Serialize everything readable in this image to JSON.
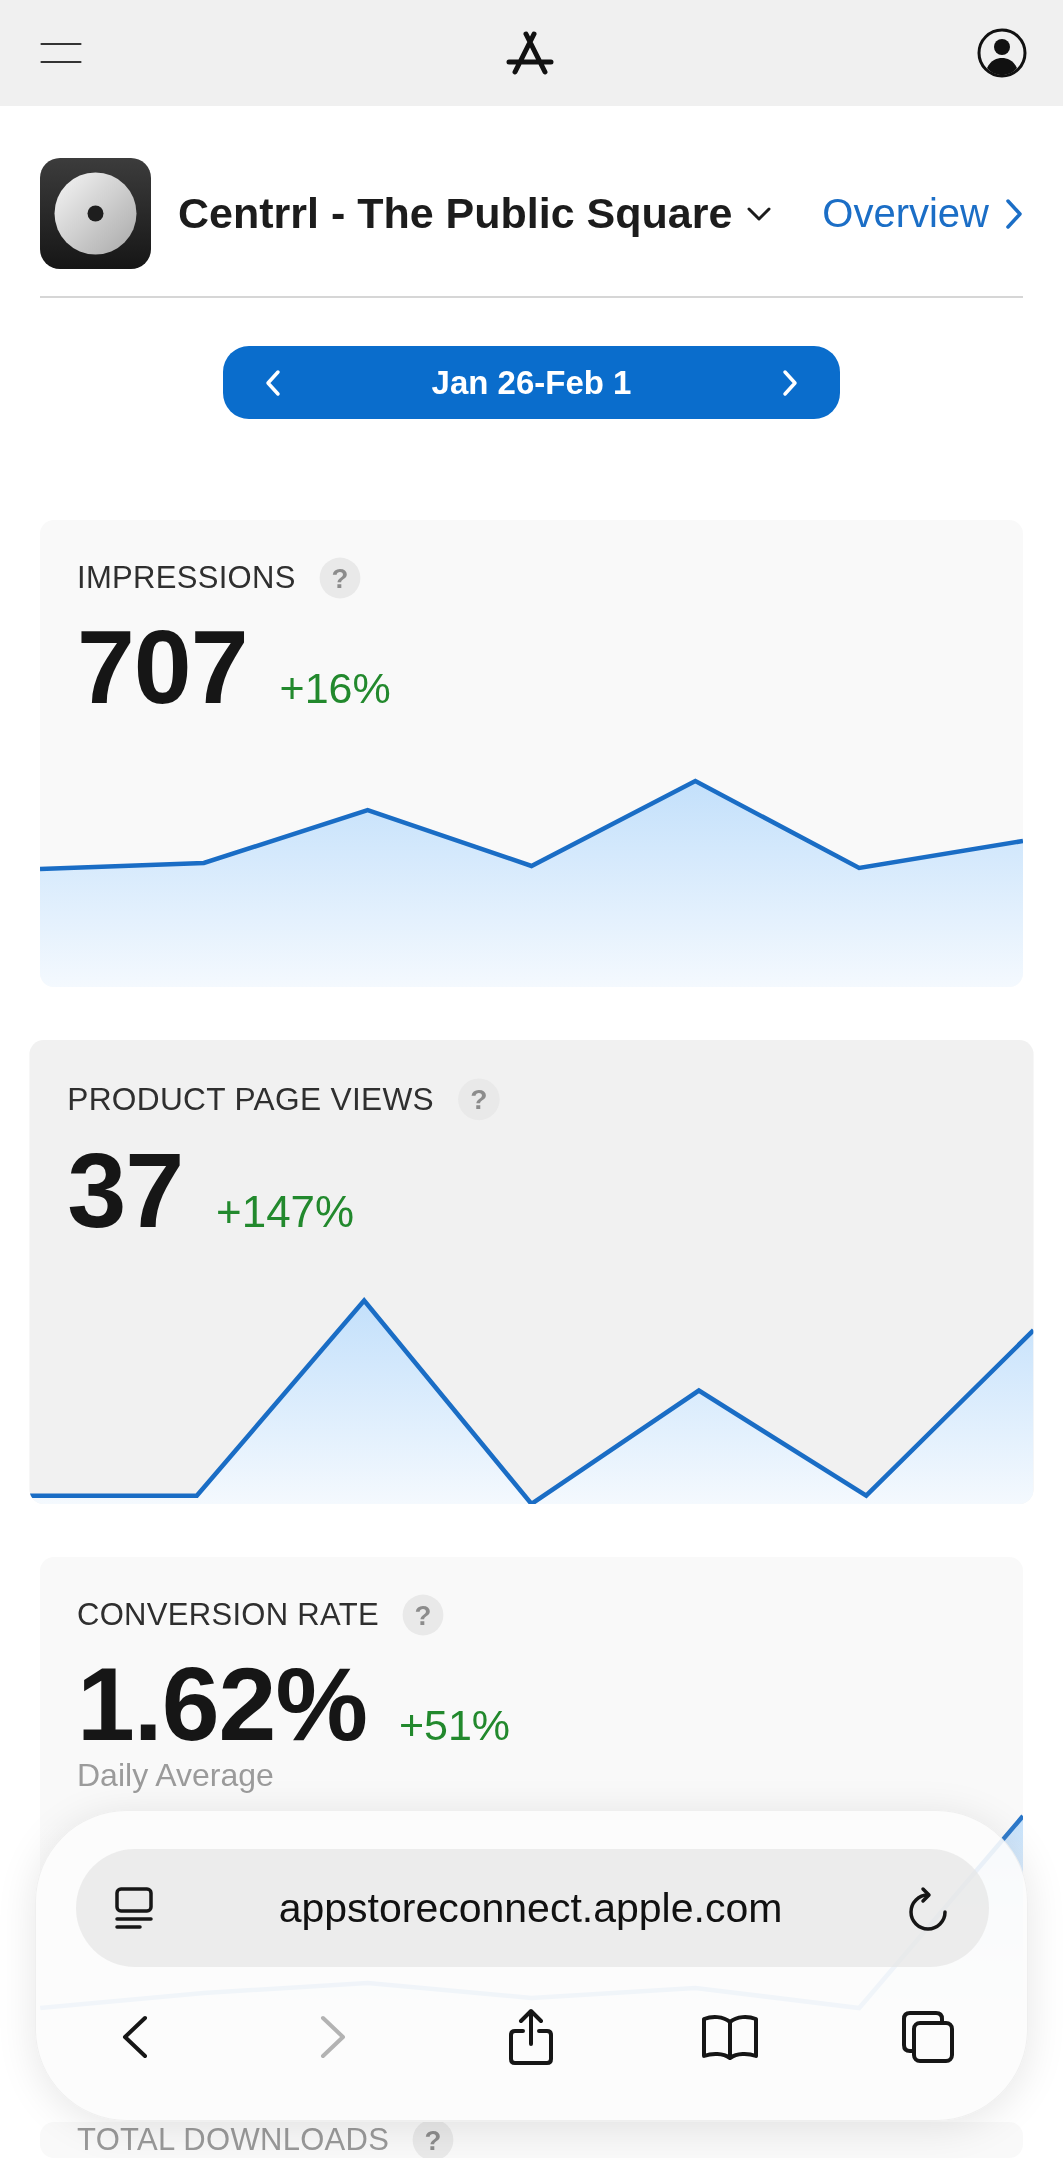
{
  "app": {
    "name": "Centrrl - The Public Square",
    "link": "Overview"
  },
  "date_range": {
    "label": "Jan 26-Feb 1"
  },
  "metrics": [
    {
      "title": "IMPRESSIONS",
      "help": "?",
      "value": "707",
      "change": "+16%",
      "selected": false
    },
    {
      "title": "PRODUCT PAGE VIEWS",
      "help": "?",
      "value": "37",
      "change": "+147%",
      "selected": true
    },
    {
      "title": "CONVERSION RATE",
      "help": "?",
      "value": "1.62%",
      "change": "+51%",
      "note": "Daily Average",
      "selected": false
    },
    {
      "title": "TOTAL DOWNLOADS",
      "help": "?",
      "selected": false
    }
  ],
  "browser": {
    "address": "appstoreconnect.apple.com",
    "buttons": [
      {
        "kind": "back",
        "disabled": false
      },
      {
        "kind": "forward",
        "disabled": true
      },
      {
        "kind": "share",
        "disabled": false
      },
      {
        "kind": "bookmarks",
        "disabled": false
      },
      {
        "kind": "tabs",
        "disabled": false
      }
    ]
  }
}
